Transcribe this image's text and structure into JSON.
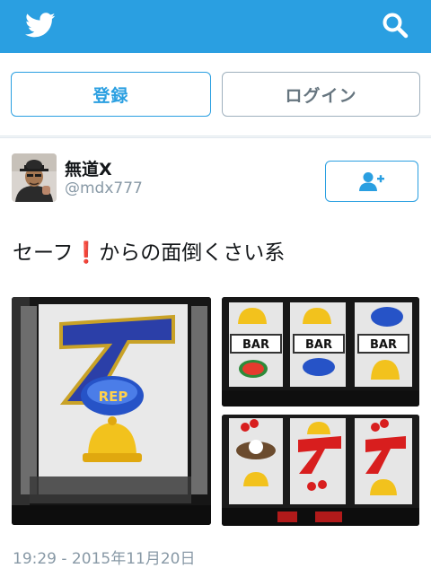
{
  "header": {
    "logo_icon": "twitter-bird-icon",
    "search_icon": "search-icon",
    "bar_color": "#2a9fe1"
  },
  "auth": {
    "register_label": "登録",
    "login_label": "ログイン"
  },
  "tweet": {
    "display_name": "無道X",
    "username": "@mdx777",
    "follow_icon": "add-user-icon",
    "text_before": "セーフ",
    "emoji": "❗",
    "text_after": "からの面倒くさい系",
    "media": {
      "left": {
        "reel_label": "REP"
      },
      "top_right": {
        "symbol_label": "BAR"
      },
      "bottom_right": {}
    },
    "timestamp": "19:29 - 2015年11月20日"
  }
}
